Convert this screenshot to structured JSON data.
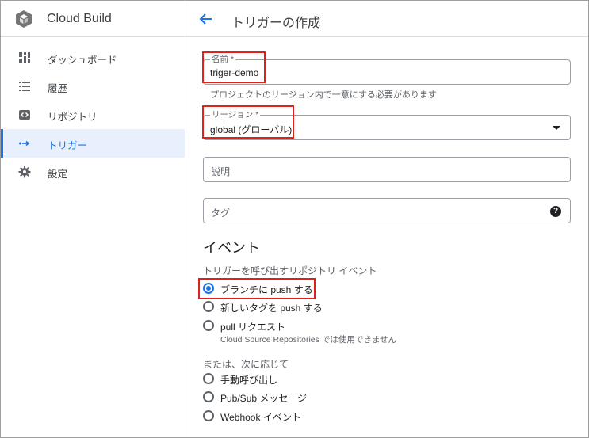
{
  "app": {
    "title": "Cloud Build",
    "logo_icon": "cloud-build-icon"
  },
  "sidebar": {
    "items": [
      {
        "label": "ダッシュボード",
        "icon": "dashboard-icon",
        "active": false
      },
      {
        "label": "履歴",
        "icon": "history-list-icon",
        "active": false
      },
      {
        "label": "リポジトリ",
        "icon": "repository-icon",
        "active": false
      },
      {
        "label": "トリガー",
        "icon": "trigger-icon",
        "active": true
      },
      {
        "label": "設定",
        "icon": "gear-icon",
        "active": false
      }
    ]
  },
  "header": {
    "back_icon": "arrow-back-icon",
    "title": "トリガーの作成"
  },
  "form": {
    "name": {
      "label": "名前 *",
      "value": "triger-demo",
      "hint": "プロジェクトのリージョン内で一意にする必要があります"
    },
    "region": {
      "label": "リージョン *",
      "value": "global (グローバル)"
    },
    "description": {
      "placeholder": "説明"
    },
    "tags": {
      "placeholder": "タグ",
      "help_icon": "?"
    }
  },
  "event": {
    "title": "イベント",
    "subtitle": "トリガーを呼び出すリポジトリ イベント",
    "options": [
      {
        "label": "ブランチに push する",
        "checked": true
      },
      {
        "label": "新しいタグを push する",
        "checked": false
      },
      {
        "label": "pull リクエスト",
        "checked": false,
        "description": "Cloud Source Repositories では使用できません"
      }
    ],
    "alt_subtitle": "または、次に応じて",
    "alt_options": [
      {
        "label": "手動呼び出し",
        "checked": false
      },
      {
        "label": "Pub/Sub メッセージ",
        "checked": false
      },
      {
        "label": "Webhook イベント",
        "checked": false
      }
    ]
  },
  "colors": {
    "accent": "#1a73e8",
    "highlight": "#e0201c",
    "active_bg": "#e8f0fe"
  }
}
